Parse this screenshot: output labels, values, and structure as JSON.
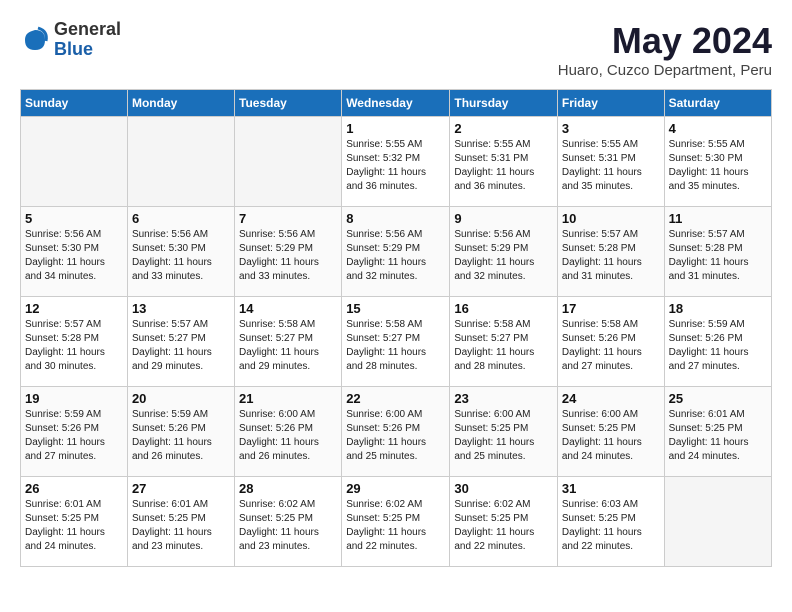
{
  "logo": {
    "general": "General",
    "blue": "Blue"
  },
  "title": "May 2024",
  "location": "Huaro, Cuzco Department, Peru",
  "weekdays": [
    "Sunday",
    "Monday",
    "Tuesday",
    "Wednesday",
    "Thursday",
    "Friday",
    "Saturday"
  ],
  "weeks": [
    [
      {
        "day": "",
        "empty": true
      },
      {
        "day": "",
        "empty": true
      },
      {
        "day": "",
        "empty": true
      },
      {
        "day": "1",
        "sunrise": "5:55 AM",
        "sunset": "5:32 PM",
        "daylight": "11 hours and 36 minutes."
      },
      {
        "day": "2",
        "sunrise": "5:55 AM",
        "sunset": "5:31 PM",
        "daylight": "11 hours and 36 minutes."
      },
      {
        "day": "3",
        "sunrise": "5:55 AM",
        "sunset": "5:31 PM",
        "daylight": "11 hours and 35 minutes."
      },
      {
        "day": "4",
        "sunrise": "5:55 AM",
        "sunset": "5:30 PM",
        "daylight": "11 hours and 35 minutes."
      }
    ],
    [
      {
        "day": "5",
        "sunrise": "5:56 AM",
        "sunset": "5:30 PM",
        "daylight": "11 hours and 34 minutes."
      },
      {
        "day": "6",
        "sunrise": "5:56 AM",
        "sunset": "5:30 PM",
        "daylight": "11 hours and 33 minutes."
      },
      {
        "day": "7",
        "sunrise": "5:56 AM",
        "sunset": "5:29 PM",
        "daylight": "11 hours and 33 minutes."
      },
      {
        "day": "8",
        "sunrise": "5:56 AM",
        "sunset": "5:29 PM",
        "daylight": "11 hours and 32 minutes."
      },
      {
        "day": "9",
        "sunrise": "5:56 AM",
        "sunset": "5:29 PM",
        "daylight": "11 hours and 32 minutes."
      },
      {
        "day": "10",
        "sunrise": "5:57 AM",
        "sunset": "5:28 PM",
        "daylight": "11 hours and 31 minutes."
      },
      {
        "day": "11",
        "sunrise": "5:57 AM",
        "sunset": "5:28 PM",
        "daylight": "11 hours and 31 minutes."
      }
    ],
    [
      {
        "day": "12",
        "sunrise": "5:57 AM",
        "sunset": "5:28 PM",
        "daylight": "11 hours and 30 minutes."
      },
      {
        "day": "13",
        "sunrise": "5:57 AM",
        "sunset": "5:27 PM",
        "daylight": "11 hours and 29 minutes."
      },
      {
        "day": "14",
        "sunrise": "5:58 AM",
        "sunset": "5:27 PM",
        "daylight": "11 hours and 29 minutes."
      },
      {
        "day": "15",
        "sunrise": "5:58 AM",
        "sunset": "5:27 PM",
        "daylight": "11 hours and 28 minutes."
      },
      {
        "day": "16",
        "sunrise": "5:58 AM",
        "sunset": "5:27 PM",
        "daylight": "11 hours and 28 minutes."
      },
      {
        "day": "17",
        "sunrise": "5:58 AM",
        "sunset": "5:26 PM",
        "daylight": "11 hours and 27 minutes."
      },
      {
        "day": "18",
        "sunrise": "5:59 AM",
        "sunset": "5:26 PM",
        "daylight": "11 hours and 27 minutes."
      }
    ],
    [
      {
        "day": "19",
        "sunrise": "5:59 AM",
        "sunset": "5:26 PM",
        "daylight": "11 hours and 27 minutes."
      },
      {
        "day": "20",
        "sunrise": "5:59 AM",
        "sunset": "5:26 PM",
        "daylight": "11 hours and 26 minutes."
      },
      {
        "day": "21",
        "sunrise": "6:00 AM",
        "sunset": "5:26 PM",
        "daylight": "11 hours and 26 minutes."
      },
      {
        "day": "22",
        "sunrise": "6:00 AM",
        "sunset": "5:26 PM",
        "daylight": "11 hours and 25 minutes."
      },
      {
        "day": "23",
        "sunrise": "6:00 AM",
        "sunset": "5:25 PM",
        "daylight": "11 hours and 25 minutes."
      },
      {
        "day": "24",
        "sunrise": "6:00 AM",
        "sunset": "5:25 PM",
        "daylight": "11 hours and 24 minutes."
      },
      {
        "day": "25",
        "sunrise": "6:01 AM",
        "sunset": "5:25 PM",
        "daylight": "11 hours and 24 minutes."
      }
    ],
    [
      {
        "day": "26",
        "sunrise": "6:01 AM",
        "sunset": "5:25 PM",
        "daylight": "11 hours and 24 minutes."
      },
      {
        "day": "27",
        "sunrise": "6:01 AM",
        "sunset": "5:25 PM",
        "daylight": "11 hours and 23 minutes."
      },
      {
        "day": "28",
        "sunrise": "6:02 AM",
        "sunset": "5:25 PM",
        "daylight": "11 hours and 23 minutes."
      },
      {
        "day": "29",
        "sunrise": "6:02 AM",
        "sunset": "5:25 PM",
        "daylight": "11 hours and 22 minutes."
      },
      {
        "day": "30",
        "sunrise": "6:02 AM",
        "sunset": "5:25 PM",
        "daylight": "11 hours and 22 minutes."
      },
      {
        "day": "31",
        "sunrise": "6:03 AM",
        "sunset": "5:25 PM",
        "daylight": "11 hours and 22 minutes."
      },
      {
        "day": "",
        "empty": true
      }
    ]
  ],
  "labels": {
    "sunrise_prefix": "Sunrise: ",
    "sunset_prefix": "Sunset: ",
    "daylight_prefix": "Daylight: "
  }
}
